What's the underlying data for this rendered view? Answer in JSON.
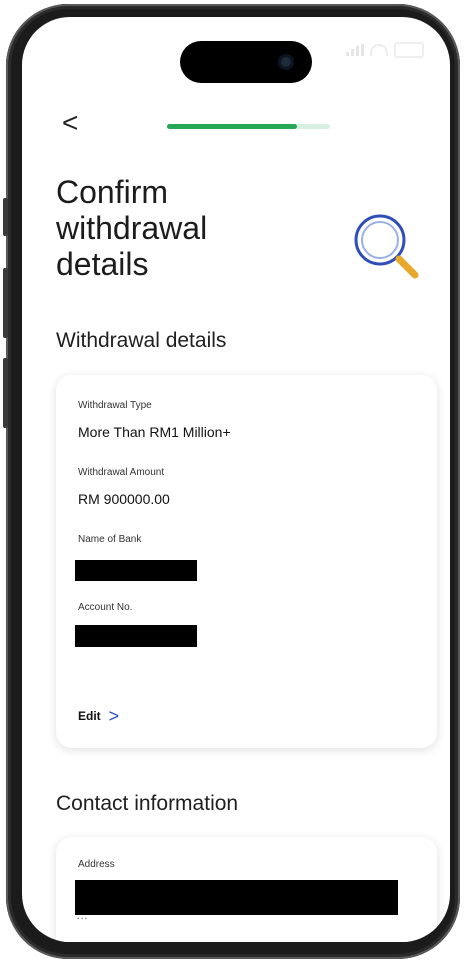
{
  "progress": {
    "fraction": 0.8
  },
  "header": {
    "back_glyph": "<"
  },
  "title": {
    "line1": "Confirm",
    "line2": "withdrawal",
    "line3": "details"
  },
  "withdrawal": {
    "heading": "Withdrawal details",
    "type_label": "Withdrawal Type",
    "type_value": "More Than RM1 Million+",
    "amount_label": "Withdrawal Amount",
    "amount_value": "RM 900000.00",
    "bank_label": "Name of Bank",
    "account_label": "Account No.",
    "edit_label": "Edit",
    "edit_chevron": ">"
  },
  "contact": {
    "heading": "Contact information",
    "address_label": "Address",
    "address_partial": "…"
  },
  "colors": {
    "progress_fill": "#27a857",
    "progress_track": "#d7efe0",
    "accent_blue": "#2f4fb8",
    "magnifier_handle": "#e6a92b"
  },
  "icons": {
    "back": "chevron-left-icon",
    "magnifier": "magnifier-icon",
    "edit": "chevron-right-icon"
  }
}
